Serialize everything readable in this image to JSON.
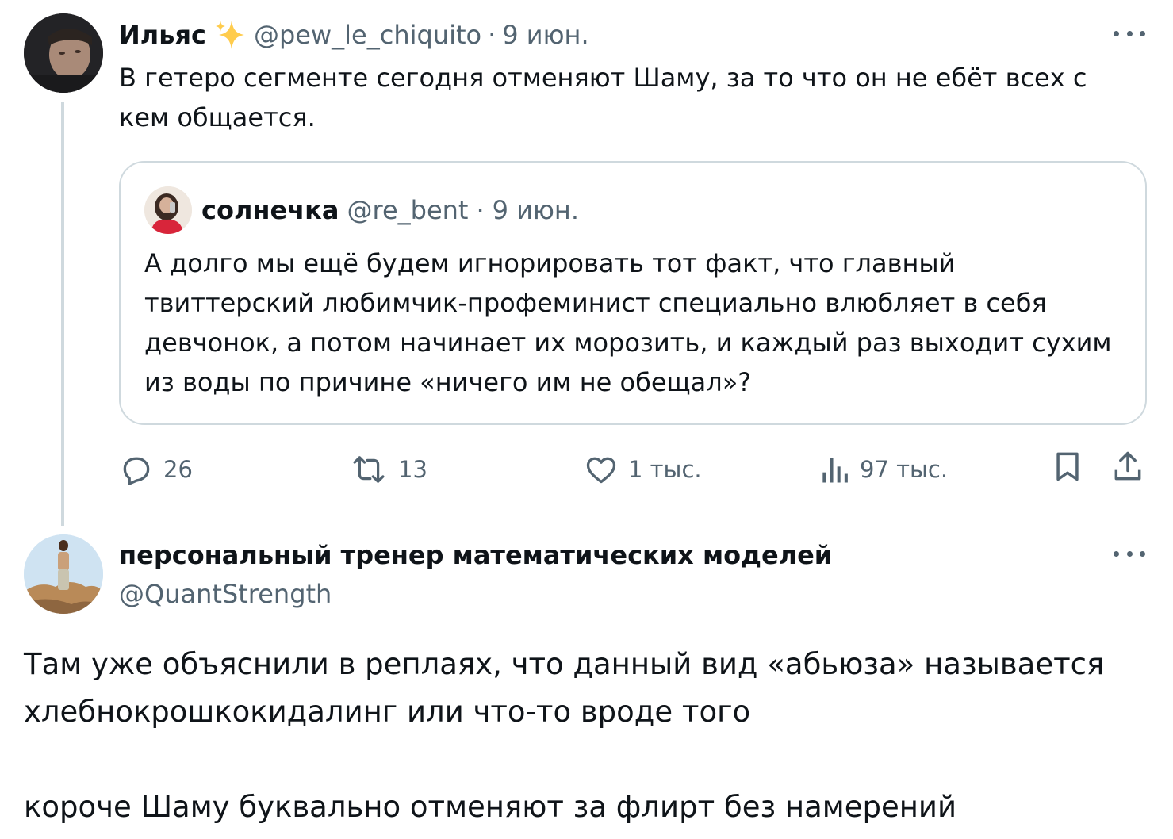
{
  "parent_tweet": {
    "author_name": "Ильяс",
    "handle": "@pew_le_chiquito",
    "date": "9 июн.",
    "separator": "·",
    "text": "В гетеро сегменте сегодня отменяют Шаму, за то что он не ебёт всех с кем общается.",
    "quoted": {
      "author_name": "солнечка",
      "handle": "@re_bent",
      "date": "9 июн.",
      "separator": "·",
      "text": "А долго мы ещё будем игнорировать тот факт, что главный твиттерский любимчик-профеминист специально влюбляет в себя девчонок, а потом начинает их морозить, и каждый раз выходит сухим из воды по причине «ничего им не обещал»?"
    },
    "actions": {
      "replies": "26",
      "reposts": "13",
      "likes": "1 тыс.",
      "views": "97 тыс."
    }
  },
  "reply_tweet": {
    "author_name": "персональный тренер математических моделей",
    "handle": "@QuantStrength",
    "paragraphs": [
      "Там уже объяснили в реплаях, что данный вид «абьюза» называется хлебнокрошкокидалинг или что-то вроде того",
      "короче Шаму буквально отменяют за флирт без намерений"
    ]
  },
  "colors": {
    "text_primary": "#0f1419",
    "text_secondary": "#536471",
    "border": "#cfd9de",
    "sparkle": "#ffcc4d"
  },
  "icons": [
    "sparkle-emoji",
    "more-icon",
    "reply-icon",
    "repost-icon",
    "like-icon",
    "views-icon",
    "bookmark-icon",
    "share-icon"
  ]
}
